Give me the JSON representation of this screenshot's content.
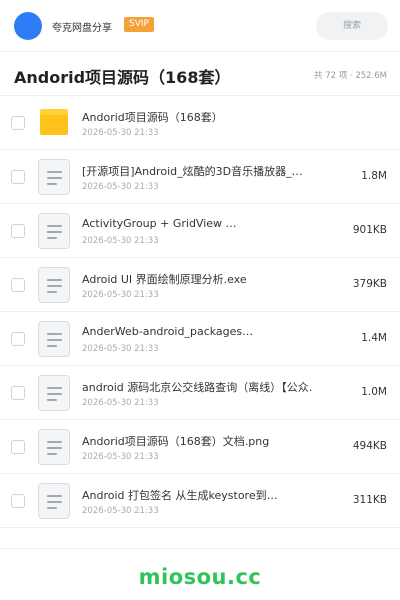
{
  "header": {
    "share_name": "夸克网盘分享",
    "badge": "SVIP",
    "search_placeholder": "搜索",
    "avatar_color": "#2f7df6",
    "badge_color": "#f3a23a"
  },
  "folder": {
    "title": "Andorid项目源码（168套）",
    "summary": "共 72 项 · 252.6M"
  },
  "files": [
    {
      "name": "Andorid项目源码（168套）",
      "date": "2026-05-30 21:33",
      "size": "",
      "icon": "folder-icon"
    },
    {
      "name": "[开源项目]Android_炫酷的3D音乐播放器_…",
      "date": "2026-05-30 21:33",
      "size": "1.8M",
      "icon": "document-icon"
    },
    {
      "name": "ActivityGroup + GridView …",
      "date": "2026-05-30 21:33",
      "size": "901KB",
      "icon": "document-icon"
    },
    {
      "name": "Adroid UI 界面绘制原理分析.exe",
      "date": "2026-05-30 21:33",
      "size": "379KB",
      "icon": "document-icon"
    },
    {
      "name": "AnderWeb-android_packages…",
      "date": "2026-05-30 21:33",
      "size": "1.4M",
      "icon": "document-icon"
    },
    {
      "name": "android 源码北京公交线路查询（离线）【公众…",
      "date": "2026-05-30 21:33",
      "size": "1.0M",
      "icon": "document-icon"
    },
    {
      "name": "Andorid项目源码（168套）文档.png",
      "date": "2026-05-30 21:33",
      "size": "494KB",
      "icon": "document-icon"
    },
    {
      "name": "Android 打包签名 从生成keystore到…",
      "date": "2026-05-30 21:33",
      "size": "311KB",
      "icon": "document-icon"
    }
  ],
  "watermark": "miosou.cc",
  "colors": {
    "folder": "#ffc21a",
    "watermark": "#2ec45a"
  }
}
